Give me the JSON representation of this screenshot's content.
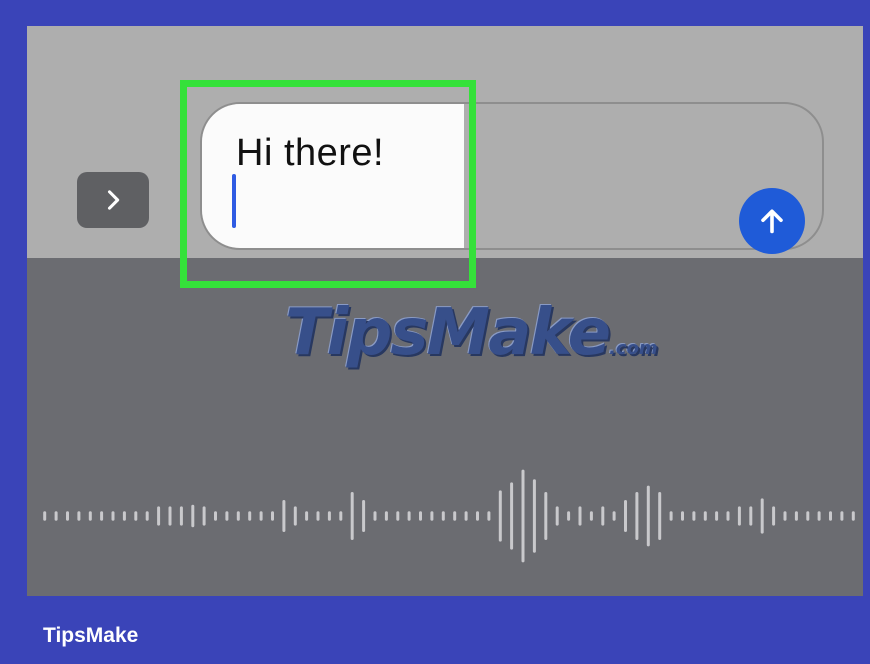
{
  "composer": {
    "message_text": "Hi there!",
    "expand_icon": "chevron-right-icon",
    "send_icon": "arrow-up-icon"
  },
  "dictation": {
    "state": "listening",
    "waveform_levels": [
      0.06,
      0.06,
      0.06,
      0.06,
      0.06,
      0.06,
      0.06,
      0.06,
      0.06,
      0.06,
      0.12,
      0.12,
      0.12,
      0.14,
      0.12,
      0.06,
      0.06,
      0.06,
      0.06,
      0.06,
      0.06,
      0.2,
      0.12,
      0.06,
      0.06,
      0.06,
      0.06,
      0.3,
      0.2,
      0.06,
      0.06,
      0.06,
      0.06,
      0.06,
      0.06,
      0.06,
      0.06,
      0.06,
      0.06,
      0.06,
      0.32,
      0.42,
      0.58,
      0.46,
      0.3,
      0.12,
      0.06,
      0.12,
      0.06,
      0.12,
      0.06,
      0.2,
      0.3,
      0.38,
      0.3,
      0.06,
      0.06,
      0.06,
      0.06,
      0.06,
      0.06,
      0.12,
      0.12,
      0.22,
      0.12,
      0.06,
      0.06,
      0.06,
      0.06,
      0.06,
      0.06,
      0.06
    ]
  },
  "watermark": {
    "brand": "TipsMake",
    "suffix": ".com"
  },
  "footer": {
    "brand": "TipsMake"
  },
  "colors": {
    "frame_background": "#3a44b8",
    "highlight": "#35e13a",
    "send_button": "#1f5bd8",
    "caret": "#2f5be3"
  }
}
